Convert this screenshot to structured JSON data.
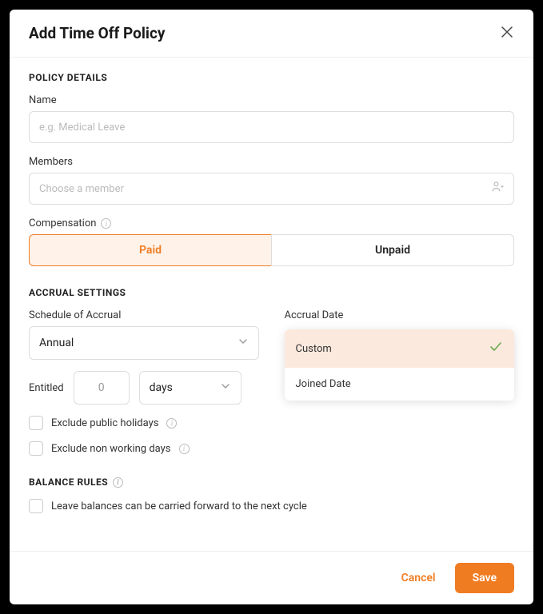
{
  "header": {
    "title": "Add Time Off Policy"
  },
  "policy_details": {
    "section_title": "POLICY DETAILS",
    "name_label": "Name",
    "name_placeholder": "e.g. Medical Leave",
    "name_value": "",
    "members_label": "Members",
    "members_placeholder": "Choose a member",
    "members_value": "",
    "compensation_label": "Compensation",
    "compensation_options": {
      "paid": "Paid",
      "unpaid": "Unpaid"
    },
    "compensation_selected": "paid"
  },
  "accrual": {
    "section_title": "ACCRUAL SETTINGS",
    "schedule_label": "Schedule of Accrual",
    "schedule_value": "Annual",
    "accrual_date_label": "Accrual Date",
    "accrual_date_options": [
      {
        "label": "Custom",
        "selected": true
      },
      {
        "label": "Joined Date",
        "selected": false
      }
    ],
    "entitled_label": "Entitled",
    "entitled_value": "0",
    "entitled_unit": "days",
    "exclude_public_holidays_label": "Exclude public holidays",
    "exclude_public_holidays_checked": false,
    "exclude_non_working_days_label": "Exclude non working days",
    "exclude_non_working_days_checked": false
  },
  "balance_rules": {
    "section_title": "BALANCE RULES",
    "carry_forward_label": "Leave balances can be carried forward to the next cycle",
    "carry_forward_checked": false
  },
  "footer": {
    "cancel_label": "Cancel",
    "save_label": "Save"
  }
}
